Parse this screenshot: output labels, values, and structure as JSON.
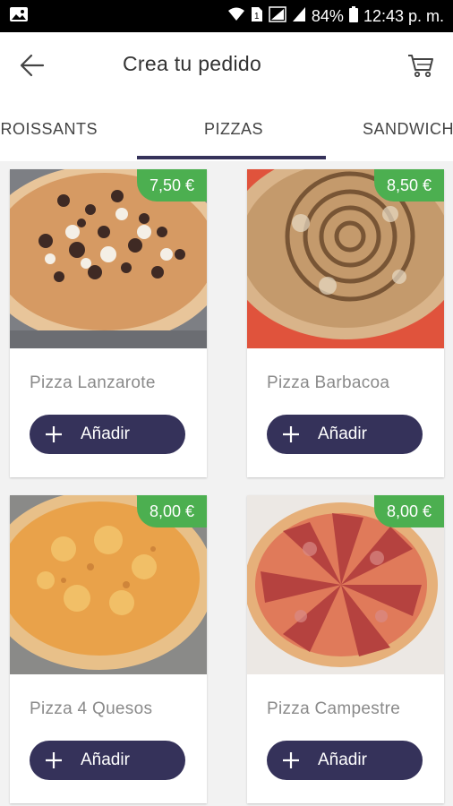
{
  "status_bar": {
    "battery": "84%",
    "time": "12:43 p. m."
  },
  "header": {
    "title": "Crea tu pedido"
  },
  "tabs": [
    {
      "label": "CROISSANTS"
    },
    {
      "label": "PIZZAS"
    },
    {
      "label": "SANDWICHES"
    }
  ],
  "active_tab": "PIZZAS",
  "products": [
    {
      "name": "Pizza Lanzarote",
      "price": "7,50 €",
      "add_label": "Añadir"
    },
    {
      "name": "Pizza Barbacoa",
      "price": "8,50 €",
      "add_label": "Añadir"
    },
    {
      "name": "Pizza 4 Quesos",
      "price": "8,00 €",
      "add_label": "Añadir"
    },
    {
      "name": "Pizza Campestre",
      "price": "8,00 €",
      "add_label": "Añadir"
    }
  ],
  "colors": {
    "accent": "#35325a",
    "price_badge": "#4caf50"
  }
}
